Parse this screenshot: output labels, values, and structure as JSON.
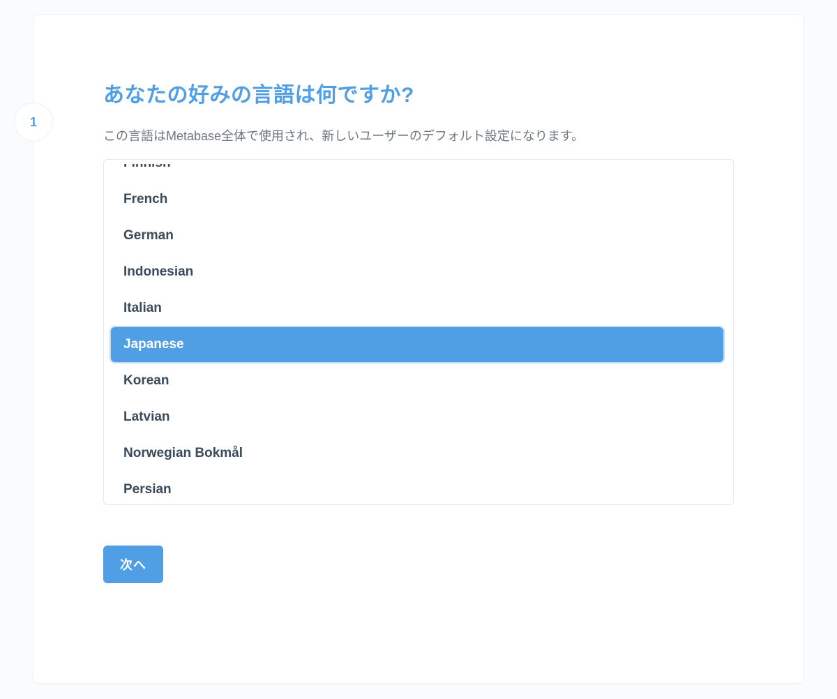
{
  "step": {
    "number": "1",
    "title": "あなたの好みの言語は何ですか?",
    "description": "この言語はMetabase全体で使用され、新しいユーザーのデフォルト設定になります。"
  },
  "languages": {
    "items": [
      {
        "label": "Finnish",
        "selected": false
      },
      {
        "label": "French",
        "selected": false
      },
      {
        "label": "German",
        "selected": false
      },
      {
        "label": "Indonesian",
        "selected": false
      },
      {
        "label": "Italian",
        "selected": false
      },
      {
        "label": "Japanese",
        "selected": true
      },
      {
        "label": "Korean",
        "selected": false
      },
      {
        "label": "Latvian",
        "selected": false
      },
      {
        "label": "Norwegian Bokmål",
        "selected": false
      },
      {
        "label": "Persian",
        "selected": false
      }
    ]
  },
  "actions": {
    "next_label": "次へ"
  }
}
